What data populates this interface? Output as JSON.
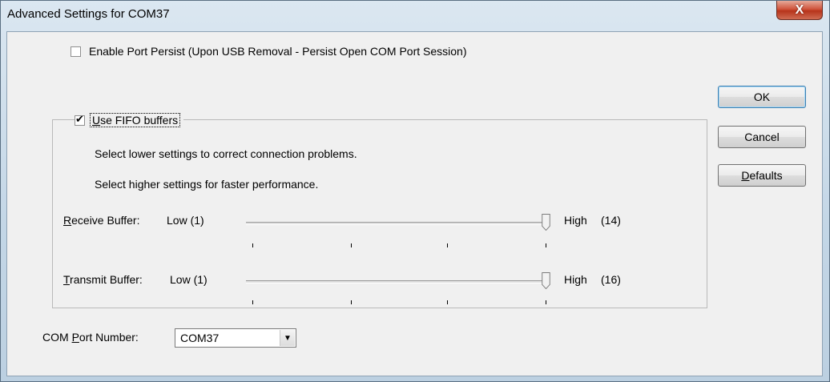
{
  "window": {
    "title": "Advanced Settings for COM37",
    "close_glyph": "X"
  },
  "persist": {
    "checked": false,
    "label": "Enable Port Persist (Upon USB Removal - Persist Open COM Port Session)"
  },
  "fifo": {
    "checked": true,
    "label_u": "U",
    "label_rest": "se FIFO buffers",
    "info_lower": "Select lower settings to correct connection problems.",
    "info_higher": "Select higher settings for faster performance.",
    "receive": {
      "label_u": "R",
      "label_rest": "eceive Buffer:",
      "low_label": "Low (1)",
      "high_label": "High",
      "value": "(14)"
    },
    "transmit": {
      "label_u": "T",
      "label_rest": "ransmit Buffer:",
      "low_label": "Low (1)",
      "high_label": "High",
      "value": "(16)"
    }
  },
  "com_port": {
    "label_pre": "COM ",
    "label_u": "P",
    "label_rest": "ort Number:",
    "selected": "COM37"
  },
  "buttons": {
    "ok": "OK",
    "cancel": "Cancel",
    "defaults_u": "D",
    "defaults_rest": "efaults"
  }
}
